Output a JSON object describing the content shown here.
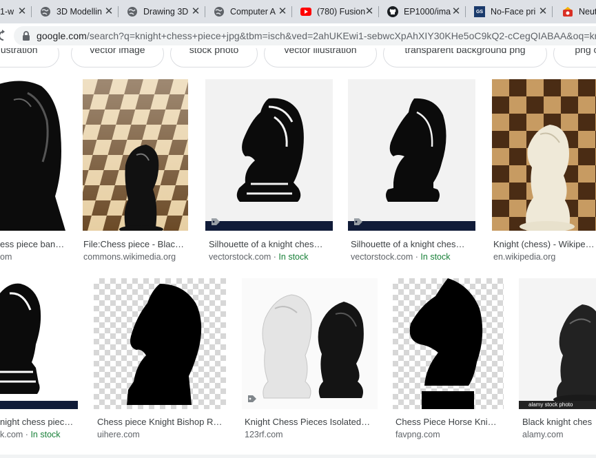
{
  "tabs": [
    {
      "title": "1-w",
      "icon": "globe-icon"
    },
    {
      "title": "3D Modellin",
      "icon": "globe-icon"
    },
    {
      "title": "Drawing 3D",
      "icon": "globe-icon"
    },
    {
      "title": "Computer A",
      "icon": "globe-icon"
    },
    {
      "title": "(780) Fusion",
      "icon": "youtube-icon"
    },
    {
      "title": "EP1000/ima",
      "icon": "github-icon"
    },
    {
      "title": "No-Face pri",
      "icon": "gs-icon",
      "icon_text": "GS"
    },
    {
      "title": "Neut",
      "icon": "app-icon"
    }
  ],
  "tab_close_glyph": "✕",
  "address_bar": {
    "host": "google.com",
    "path": "/search?q=knight+chess+piece+jpg&tbm=isch&ved=2ahUKEwi1-sebwcXpAhXIY30KHe5oC9kQ2-cCegQIABAA&oq=kni"
  },
  "chips": [
    "illustration",
    "vector image",
    "stock photo",
    "vector illustration",
    "transparent background png",
    "png cl"
  ],
  "results": [
    {
      "title": "ess piece ban…",
      "source": "om",
      "in_stock": ""
    },
    {
      "title": "File:Chess piece - Blac…",
      "source": "commons.wikimedia.org",
      "in_stock": ""
    },
    {
      "title": "Silhouette of a knight ches…",
      "source": "vectorstock.com · ",
      "in_stock": "In stock"
    },
    {
      "title": "Silhouette of a knight ches…",
      "source": "vectorstock.com · ",
      "in_stock": "In stock"
    },
    {
      "title": "Knight (chess) - Wikipe…",
      "source": "en.wikipedia.org",
      "in_stock": ""
    },
    {
      "title": "night chess piec…",
      "source": "k.com · ",
      "in_stock": "In stock"
    },
    {
      "title": "Chess piece Knight Bishop R…",
      "source": "uihere.com",
      "in_stock": ""
    },
    {
      "title": "Knight Chess Pieces Isolated…",
      "source": "123rf.com",
      "in_stock": ""
    },
    {
      "title": "Chess Piece Horse Kni…",
      "source": "favpng.com",
      "in_stock": ""
    },
    {
      "title": "Black knight ches",
      "source": "alamy.com",
      "in_stock": ""
    }
  ],
  "alamy_caption": "alamy stock photo"
}
